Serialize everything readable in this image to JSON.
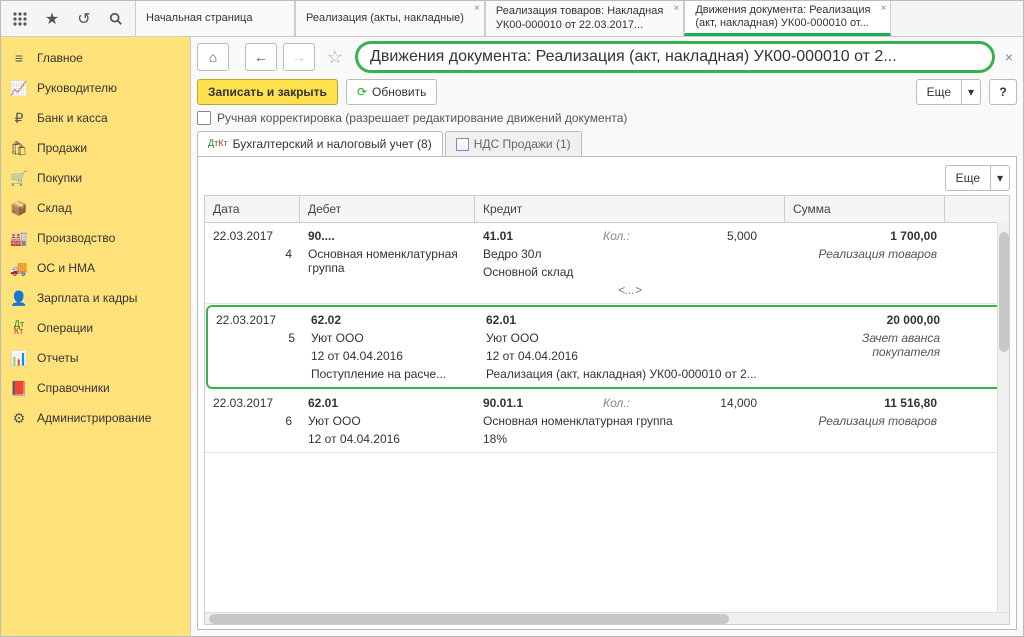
{
  "topbar": {
    "tabs": [
      {
        "title": "Начальная страница",
        "sub": ""
      },
      {
        "title": "Реализация (акты, накладные)",
        "sub": ""
      },
      {
        "title": "Реализация товаров: Накладная",
        "sub": "УК00-000010 от 22.03.2017..."
      },
      {
        "title": "Движения документа: Реализация",
        "sub": "(акт, накладная) УК00-000010 от..."
      }
    ]
  },
  "sidebar": {
    "items": [
      {
        "label": "Главное",
        "icon": "menu-icon"
      },
      {
        "label": "Руководителю",
        "icon": "chart-icon"
      },
      {
        "label": "Банк и касса",
        "icon": "ruble-icon"
      },
      {
        "label": "Продажи",
        "icon": "cart-sell-icon"
      },
      {
        "label": "Покупки",
        "icon": "cart-buy-icon"
      },
      {
        "label": "Склад",
        "icon": "warehouse-icon"
      },
      {
        "label": "Производство",
        "icon": "factory-icon"
      },
      {
        "label": "ОС и НМА",
        "icon": "truck-icon"
      },
      {
        "label": "Зарплата и кадры",
        "icon": "person-icon"
      },
      {
        "label": "Операции",
        "icon": "dtkt-icon"
      },
      {
        "label": "Отчеты",
        "icon": "report-icon"
      },
      {
        "label": "Справочники",
        "icon": "book-icon"
      },
      {
        "label": "Администрирование",
        "icon": "gear-icon"
      }
    ]
  },
  "main": {
    "title": "Движения документа: Реализация (акт, накладная) УК00-000010 от 2...",
    "btn_save_close": "Записать и закрыть",
    "btn_refresh": "Обновить",
    "btn_more": "Еще",
    "btn_help": "?",
    "checkbox_label": "Ручная корректировка (разрешает редактирование движений документа)",
    "inner_tab1": "Бухгалтерский и налоговый учет (8)",
    "inner_tab2": "НДС Продажи (1)",
    "grid": {
      "headers": {
        "date": "Дата",
        "debet": "Дебет",
        "kredit": "Кредит",
        "sum": "Сумма"
      },
      "rows": [
        {
          "date": "22.03.2017",
          "n": "4",
          "deb_main": "90....",
          "deb_l2": "Основная номенклатурная группа",
          "kr_main": "41.01",
          "kol": "Кол.:",
          "kol_val": "5,000",
          "kr_l2": "Ведро 30л",
          "kr_l3": "Основной склад",
          "kr_l4": "<...>",
          "sum": "1 700,00",
          "desc": "Реализация товаров"
        },
        {
          "highlight": true,
          "date": "22.03.2017",
          "n": "5",
          "deb_main": "62.02",
          "deb_l2": "Уют ООО",
          "deb_l3": "12 от 04.04.2016",
          "deb_l4": "Поступление на расче...",
          "kr_main": "62.01",
          "kr_l2": "Уют ООО",
          "kr_l3": "12 от 04.04.2016",
          "kr_l4": "Реализация (акт, накладная) УК00-000010 от 2...",
          "sum": "20 000,00",
          "desc": "Зачет аванса покупателя"
        },
        {
          "date": "22.03.2017",
          "n": "6",
          "deb_main": "62.01",
          "deb_l2": "Уют ООО",
          "deb_l3": "12 от 04.04.2016",
          "kr_main": "90.01.1",
          "kol": "Кол.:",
          "kol_val": "14,000",
          "kr_l2": "Основная номенклатурная группа",
          "kr_l3": "18%",
          "sum": "11 516,80",
          "desc": "Реализация товаров"
        }
      ]
    }
  }
}
